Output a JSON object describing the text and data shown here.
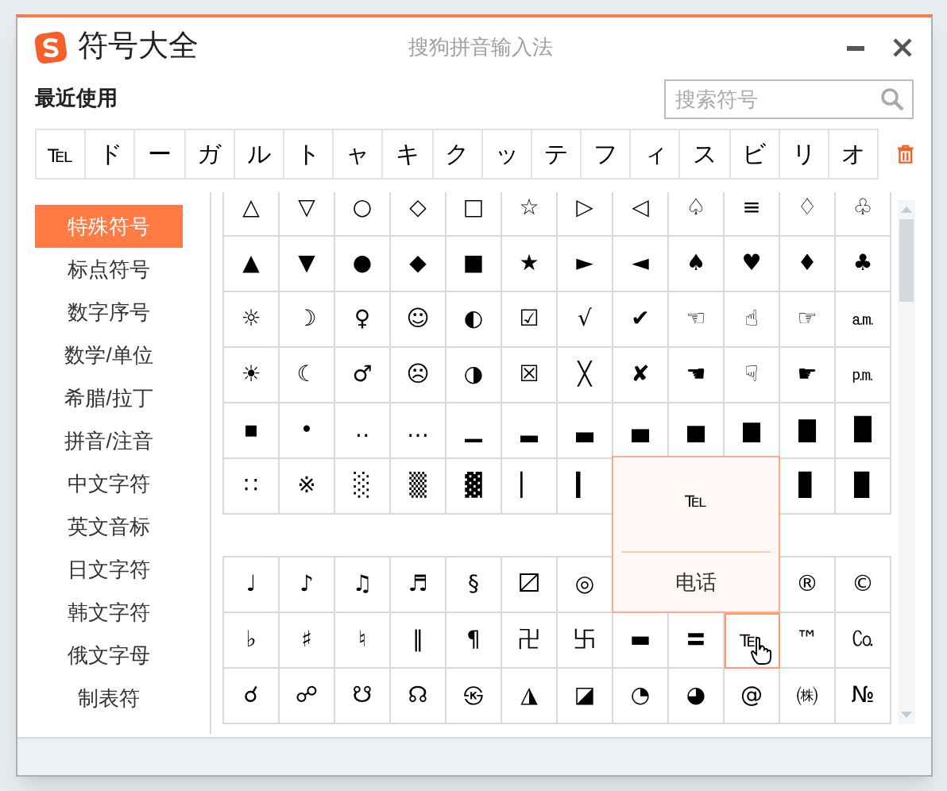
{
  "window": {
    "title": "符号大全",
    "app_name": "搜狗拼音输入法"
  },
  "recent": {
    "label": "最近使用",
    "symbols": [
      "℡",
      "ド",
      "ー",
      "ガ",
      "ル",
      "ト",
      "ャ",
      "キ",
      "ク",
      "ッ",
      "テ",
      "フ",
      "ィ",
      "ス",
      "ビ",
      "リ",
      "オ"
    ]
  },
  "search": {
    "placeholder": "搜索符号"
  },
  "sidebar": {
    "items": [
      {
        "label": "特殊符号",
        "selected": true
      },
      {
        "label": "标点符号",
        "selected": false
      },
      {
        "label": "数字序号",
        "selected": false
      },
      {
        "label": "数学/单位",
        "selected": false
      },
      {
        "label": "希腊/拉丁",
        "selected": false
      },
      {
        "label": "拼音/注音",
        "selected": false
      },
      {
        "label": "中文字符",
        "selected": false
      },
      {
        "label": "英文音标",
        "selected": false
      },
      {
        "label": "日文字符",
        "selected": false
      },
      {
        "label": "韩文字符",
        "selected": false
      },
      {
        "label": "俄文字母",
        "selected": false
      },
      {
        "label": "制表符",
        "selected": false
      }
    ]
  },
  "grids": [
    {
      "rows": [
        [
          "△",
          "▽",
          "○",
          "◇",
          "□",
          "☆",
          "▷",
          "◁",
          "♤",
          "≡",
          "♢",
          "♧"
        ],
        [
          "▲",
          "▼",
          "●",
          "◆",
          "■",
          "★",
          "►",
          "◄",
          "♠",
          "♥",
          "♦",
          "♣"
        ],
        [
          "☼",
          "☽",
          "♀",
          "☺",
          "◐",
          "☑",
          "√",
          "✔",
          "☜",
          "☝",
          "☞",
          "㏂"
        ],
        [
          "☀",
          "☾",
          "♂",
          "☹",
          "◑",
          "☒",
          "╳",
          "✘",
          "☚",
          "☟",
          "☛",
          "㏘"
        ],
        [
          "▪",
          "•",
          "‥",
          "…",
          "▁",
          "▂",
          "▃",
          "▄",
          "▅",
          "▆",
          "▇",
          "█"
        ],
        [
          "∷",
          "※",
          "░",
          "▒",
          "▓",
          "▏",
          "▎",
          null,
          null,
          null,
          "▊",
          "▉"
        ]
      ]
    },
    {
      "rows": [
        [
          "♩",
          "♪",
          "♫",
          "♬",
          "§",
          "〼",
          "◎",
          null,
          null,
          null,
          "®",
          "©"
        ],
        [
          "♭",
          "♯",
          "♮",
          "‖",
          "¶",
          "卍",
          "卐",
          "▬",
          "〓",
          {
            "symbol": "℡",
            "hovered": true
          },
          "™",
          "㏇"
        ],
        [
          "☌",
          "☍",
          "☋",
          "☊",
          "㉿",
          "◮",
          "◪",
          "◔",
          "◕",
          "@",
          "㈱",
          "№"
        ]
      ]
    }
  ],
  "tooltip": {
    "symbol": "℡",
    "name": "电话"
  }
}
